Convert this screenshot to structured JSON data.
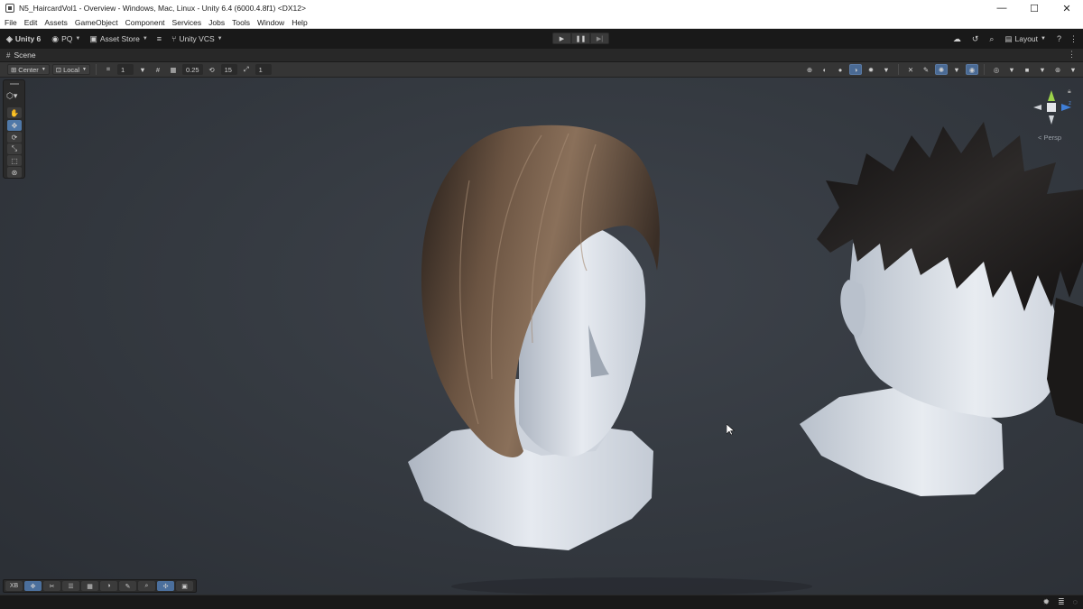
{
  "window": {
    "title": "N5_HaircardVol1 - Overview - Windows, Mac, Linux - Unity 6.4 (6000.4.8f1) <DX12>",
    "controls": {
      "minimize": "—",
      "maximize": "☐",
      "close": "✕"
    }
  },
  "menu": [
    "File",
    "Edit",
    "Assets",
    "GameObject",
    "Component",
    "Services",
    "Jobs",
    "Tools",
    "Window",
    "Help"
  ],
  "toolbar": {
    "unity_label": "Unity 6",
    "account_label": "PQ",
    "asset_store_label": "Asset Store",
    "vcs_label": "Unity VCS",
    "layout_label": "Layout"
  },
  "scene_tab": {
    "label": "Scene"
  },
  "scene_toolbar": {
    "pivot_label": "Center",
    "space_label": "Local",
    "grid_value": "1",
    "snap_value": "0.25",
    "rotation_snap_value": "15",
    "scale_snap_value": "1"
  },
  "gizmo": {
    "view_label": "< Persp",
    "axis_y": "y",
    "axis_z": "z"
  },
  "overlay_toolbar": {
    "xr_label": "XB"
  },
  "colors": {
    "accent": "#4f78a8",
    "viewport_bg": "#353a41",
    "hair_brown": "#5a4535",
    "hair_dark": "#1e1c1c",
    "skin": "#d8dde4"
  }
}
